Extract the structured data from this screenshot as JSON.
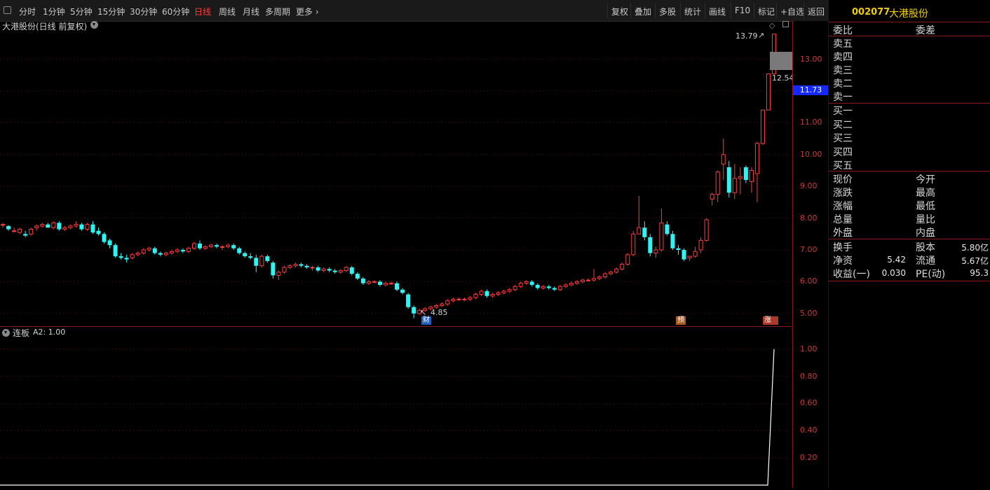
{
  "toolbar": {
    "periods": [
      "分时",
      "1分钟",
      "5分钟",
      "15分钟",
      "30分钟",
      "60分钟",
      "日线",
      "周线",
      "月线",
      "多周期",
      "更多 ›"
    ],
    "active_period": "日线",
    "actions": [
      "复权",
      "叠加",
      "多股",
      "统计",
      "画线",
      "F10",
      "标记",
      "+自选",
      "返回"
    ]
  },
  "main_chart": {
    "title": "大港股份(日线 前复权)",
    "high_label": "13.79",
    "low_label": "4.85",
    "last_label": "12.54",
    "current_price": "11.73",
    "markers": [
      {
        "text": "财",
        "color": "#1f5fbf"
      },
      {
        "text": "预",
        "color": "#b05a1e"
      },
      {
        "text": "涨",
        "color": "#b03a2a"
      }
    ],
    "y_ticks": [
      "13.00",
      "12.00",
      "11.00",
      "10.00",
      "9.00",
      "8.00",
      "7.00",
      "6.00",
      "5.00"
    ]
  },
  "indicator": {
    "title": "连板",
    "value_label": "A2: 1.00",
    "y_ticks": [
      "1.00",
      "0.80",
      "0.60",
      "0.40",
      "0.20"
    ]
  },
  "colors": {
    "up": "#ff3b3b",
    "down": "#2ff4f4",
    "axis": "#c83c3c",
    "grid": "#8a1a1a",
    "stock_code": "#f0d000"
  },
  "panel": {
    "code": "002077",
    "name": "大港股份",
    "header_left": "委比",
    "header_right": "委差",
    "sell": [
      "卖五",
      "卖四",
      "卖三",
      "卖二",
      "卖一"
    ],
    "buy": [
      "买一",
      "买二",
      "买三",
      "买四",
      "买五"
    ],
    "quote_left": [
      "现价",
      "涨跌",
      "涨幅",
      "总量",
      "外盘"
    ],
    "quote_right": [
      "今开",
      "最高",
      "最低",
      "量比",
      "内盘"
    ],
    "stats": [
      {
        "l": "换手",
        "lv": "",
        "r": "股本",
        "rv": "5.80亿"
      },
      {
        "l": "净资",
        "lv": "5.42",
        "r": "流通",
        "rv": "5.67亿"
      },
      {
        "l": "收益(一)",
        "lv": "0.030",
        "r": "PE(动)",
        "rv": "95.3"
      }
    ]
  },
  "chart_data": [
    {
      "type": "candlestick",
      "title": "大港股份(日线 前复权)",
      "ylim": [
        4.6,
        14.2
      ],
      "y_ticks": [
        5,
        6,
        7,
        8,
        9,
        10,
        11,
        12,
        13
      ],
      "candles": [
        [
          7.8,
          7.85,
          7.7,
          7.8
        ],
        [
          7.75,
          7.78,
          7.6,
          7.65
        ],
        [
          7.6,
          7.7,
          7.55,
          7.6
        ],
        [
          7.55,
          7.7,
          7.5,
          7.65
        ],
        [
          7.5,
          7.6,
          7.4,
          7.45
        ],
        [
          7.5,
          7.7,
          7.45,
          7.65
        ],
        [
          7.7,
          7.8,
          7.6,
          7.75
        ],
        [
          7.75,
          7.85,
          7.7,
          7.8
        ],
        [
          7.8,
          7.85,
          7.7,
          7.7
        ],
        [
          7.7,
          7.9,
          7.65,
          7.85
        ],
        [
          7.85,
          7.9,
          7.6,
          7.65
        ],
        [
          7.65,
          7.75,
          7.6,
          7.7
        ],
        [
          7.7,
          7.8,
          7.65,
          7.75
        ],
        [
          7.75,
          7.9,
          7.7,
          7.8
        ],
        [
          7.8,
          7.85,
          7.6,
          7.65
        ],
        [
          7.65,
          7.85,
          7.6,
          7.8
        ],
        [
          7.8,
          7.9,
          7.5,
          7.55
        ],
        [
          7.6,
          7.7,
          7.45,
          7.5
        ],
        [
          7.5,
          7.55,
          7.2,
          7.25
        ],
        [
          7.3,
          7.35,
          7.05,
          7.15
        ],
        [
          7.15,
          7.2,
          6.75,
          6.8
        ],
        [
          6.8,
          6.9,
          6.7,
          6.75
        ],
        [
          6.75,
          6.85,
          6.6,
          6.7
        ],
        [
          6.75,
          6.9,
          6.7,
          6.85
        ],
        [
          6.85,
          6.95,
          6.8,
          6.9
        ],
        [
          6.9,
          7.05,
          6.85,
          7.0
        ],
        [
          7.0,
          7.1,
          6.95,
          7.05
        ],
        [
          7.05,
          7.1,
          6.85,
          6.9
        ],
        [
          6.9,
          6.95,
          6.8,
          6.85
        ],
        [
          6.85,
          6.95,
          6.8,
          6.9
        ],
        [
          6.9,
          7.0,
          6.85,
          6.95
        ],
        [
          6.95,
          7.05,
          6.9,
          7.0
        ],
        [
          7.0,
          7.05,
          6.9,
          6.95
        ],
        [
          6.95,
          7.1,
          6.9,
          7.05
        ],
        [
          7.05,
          7.25,
          7.0,
          7.2
        ],
        [
          7.2,
          7.3,
          7.0,
          7.05
        ],
        [
          7.05,
          7.15,
          7.0,
          7.1
        ],
        [
          7.1,
          7.2,
          7.05,
          7.15
        ],
        [
          7.15,
          7.2,
          7.05,
          7.1
        ],
        [
          7.1,
          7.15,
          7.0,
          7.1
        ],
        [
          7.1,
          7.2,
          7.05,
          7.15
        ],
        [
          7.15,
          7.2,
          7.0,
          7.05
        ],
        [
          7.05,
          7.1,
          6.85,
          6.9
        ],
        [
          6.9,
          6.95,
          6.75,
          6.8
        ],
        [
          6.8,
          6.9,
          6.7,
          6.75
        ],
        [
          6.75,
          6.85,
          6.3,
          6.5
        ],
        [
          6.5,
          6.85,
          6.45,
          6.8
        ],
        [
          6.8,
          6.85,
          6.6,
          6.65
        ],
        [
          6.6,
          6.65,
          6.1,
          6.2
        ],
        [
          6.2,
          6.35,
          6.05,
          6.3
        ],
        [
          6.3,
          6.5,
          6.25,
          6.45
        ],
        [
          6.45,
          6.55,
          6.4,
          6.5
        ],
        [
          6.5,
          6.6,
          6.45,
          6.55
        ],
        [
          6.55,
          6.6,
          6.45,
          6.5
        ],
        [
          6.5,
          6.55,
          6.4,
          6.45
        ],
        [
          6.45,
          6.5,
          6.35,
          6.45
        ],
        [
          6.45,
          6.5,
          6.3,
          6.35
        ],
        [
          6.35,
          6.45,
          6.3,
          6.4
        ],
        [
          6.4,
          6.45,
          6.3,
          6.35
        ],
        [
          6.35,
          6.4,
          6.25,
          6.3
        ],
        [
          6.3,
          6.4,
          6.25,
          6.35
        ],
        [
          6.35,
          6.5,
          6.3,
          6.45
        ],
        [
          6.45,
          6.5,
          6.2,
          6.25
        ],
        [
          6.25,
          6.3,
          6.05,
          6.1
        ],
        [
          6.1,
          6.15,
          5.9,
          5.95
        ],
        [
          5.95,
          6.05,
          5.9,
          6.0
        ],
        [
          6.0,
          6.05,
          5.95,
          6.0
        ],
        [
          6.0,
          6.05,
          5.85,
          5.9
        ],
        [
          5.9,
          6.0,
          5.85,
          5.95
        ],
        [
          5.95,
          6.0,
          5.9,
          5.95
        ],
        [
          5.95,
          6.0,
          5.7,
          5.75
        ],
        [
          5.75,
          5.8,
          5.6,
          5.65
        ],
        [
          5.6,
          5.65,
          5.15,
          5.2
        ],
        [
          5.2,
          5.25,
          4.85,
          5.0
        ],
        [
          5.0,
          5.15,
          4.95,
          5.1
        ],
        [
          5.1,
          5.2,
          5.05,
          5.15
        ],
        [
          5.15,
          5.25,
          5.1,
          5.2
        ],
        [
          5.2,
          5.3,
          5.15,
          5.25
        ],
        [
          5.25,
          5.35,
          5.2,
          5.3
        ],
        [
          5.3,
          5.45,
          5.25,
          5.4
        ],
        [
          5.4,
          5.5,
          5.35,
          5.45
        ],
        [
          5.45,
          5.5,
          5.4,
          5.45
        ],
        [
          5.45,
          5.5,
          5.4,
          5.45
        ],
        [
          5.45,
          5.55,
          5.4,
          5.5
        ],
        [
          5.5,
          5.65,
          5.45,
          5.6
        ],
        [
          5.6,
          5.75,
          5.55,
          5.7
        ],
        [
          5.7,
          5.75,
          5.5,
          5.55
        ],
        [
          5.55,
          5.65,
          5.5,
          5.6
        ],
        [
          5.6,
          5.7,
          5.55,
          5.65
        ],
        [
          5.65,
          5.75,
          5.6,
          5.7
        ],
        [
          5.7,
          5.8,
          5.65,
          5.75
        ],
        [
          5.75,
          5.9,
          5.7,
          5.85
        ],
        [
          5.85,
          6.0,
          5.8,
          5.95
        ],
        [
          5.95,
          6.05,
          5.9,
          6.0
        ],
        [
          6.0,
          6.05,
          5.85,
          5.9
        ],
        [
          5.9,
          5.95,
          5.75,
          5.8
        ],
        [
          5.8,
          5.9,
          5.75,
          5.85
        ],
        [
          5.85,
          5.9,
          5.75,
          5.8
        ],
        [
          5.8,
          5.85,
          5.7,
          5.75
        ],
        [
          5.75,
          5.9,
          5.7,
          5.85
        ],
        [
          5.85,
          5.95,
          5.8,
          5.9
        ],
        [
          5.9,
          6.0,
          5.85,
          5.95
        ],
        [
          5.95,
          6.05,
          5.9,
          6.0
        ],
        [
          6.0,
          6.1,
          5.95,
          6.05
        ],
        [
          6.05,
          6.1,
          6.0,
          6.05
        ],
        [
          6.05,
          6.4,
          6.0,
          6.1
        ],
        [
          6.1,
          6.2,
          6.05,
          6.15
        ],
        [
          6.15,
          6.3,
          6.1,
          6.25
        ],
        [
          6.25,
          6.35,
          6.2,
          6.3
        ],
        [
          6.3,
          6.45,
          6.25,
          6.4
        ],
        [
          6.4,
          6.6,
          6.35,
          6.55
        ],
        [
          6.55,
          6.9,
          6.5,
          6.85
        ],
        [
          6.85,
          7.6,
          6.8,
          7.5
        ],
        [
          7.5,
          8.7,
          7.5,
          7.7
        ],
        [
          7.7,
          7.9,
          7.3,
          7.4
        ],
        [
          7.4,
          7.5,
          6.8,
          6.9
        ],
        [
          6.9,
          7.1,
          6.75,
          7.0
        ],
        [
          7.0,
          8.3,
          6.95,
          7.85
        ],
        [
          7.8,
          7.9,
          7.45,
          7.5
        ],
        [
          7.5,
          7.6,
          7.0,
          7.05
        ],
        [
          7.05,
          7.15,
          6.85,
          7.0
        ],
        [
          7.0,
          7.05,
          6.65,
          6.7
        ],
        [
          6.75,
          6.8,
          6.65,
          6.8
        ],
        [
          6.8,
          7.1,
          6.75,
          6.95
        ],
        [
          7.0,
          7.4,
          6.9,
          7.3
        ],
        [
          7.3,
          8.0,
          7.25,
          7.95
        ],
        [
          8.6,
          8.8,
          8.4,
          8.75
        ],
        [
          8.75,
          9.5,
          8.5,
          9.45
        ],
        [
          9.7,
          10.5,
          9.2,
          10.0
        ],
        [
          9.6,
          9.8,
          8.65,
          8.8
        ],
        [
          8.8,
          9.7,
          8.6,
          9.25
        ],
        [
          9.25,
          9.6,
          8.75,
          9.3
        ],
        [
          9.6,
          9.65,
          9.1,
          9.2
        ],
        [
          9.15,
          9.6,
          8.8,
          9.5
        ],
        [
          9.4,
          10.4,
          8.5,
          10.35
        ],
        [
          10.35,
          11.4,
          10.3,
          11.4
        ],
        [
          11.4,
          12.54,
          11.4,
          12.54
        ],
        [
          12.54,
          13.79,
          12.54,
          13.79
        ]
      ]
    },
    {
      "type": "line",
      "title": "连板",
      "ylim": [
        0,
        1.05
      ],
      "y_ticks": [
        0.2,
        0.4,
        0.6,
        0.8,
        1.0
      ],
      "series": [
        {
          "name": "A2",
          "values": [
            0,
            0,
            1
          ]
        }
      ]
    }
  ]
}
